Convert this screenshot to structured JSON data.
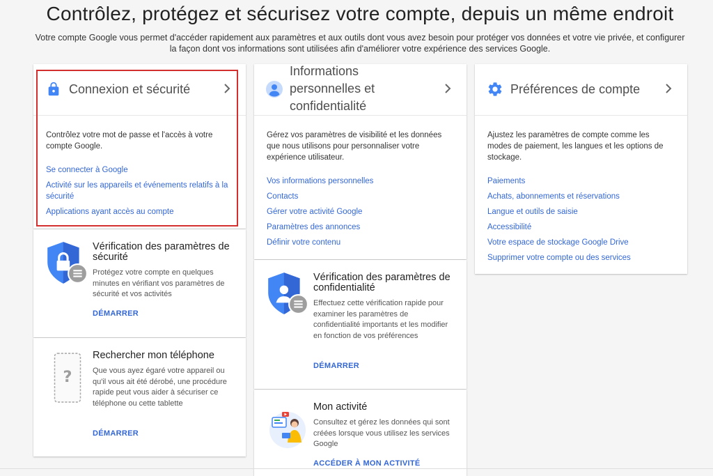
{
  "page": {
    "title": "Contrôlez, protégez et sécurisez votre compte, depuis un même endroit",
    "intro_line1": "Votre compte Google vous permet d'accéder rapidement aux paramètres et aux outils dont vous avez besoin pour protéger vos données et votre vie privée, et configurer",
    "intro_line2": "la façon dont vos informations sont utilisées afin d'améliorer votre expérience des services Google."
  },
  "colors": {
    "link": "#3367d6",
    "icon_blue": "#4285f4",
    "highlight": "#d32f2f"
  },
  "security_card": {
    "icon": "lock-icon",
    "title": "Connexion et sécurité",
    "description": "Contrôlez votre mot de passe et l'accès à votre compte Google.",
    "links": [
      "Se connecter à Google",
      "Activité sur les appareils et événements relatifs à la sécurité",
      "Applications ayant accès au compte"
    ]
  },
  "privacy_card": {
    "icon": "person-icon",
    "title": "Informations personnelles et confidentialité",
    "description": "Gérez vos paramètres de visibilité et les données que nous utilisons pour personnaliser votre expérience utilisateur.",
    "links": [
      "Vos informations personnelles",
      "Contacts",
      "Gérer votre activité Google",
      "Paramètres des annonces",
      "Définir votre contenu"
    ]
  },
  "preferences_card": {
    "icon": "gear-icon",
    "title": "Préférences de compte",
    "description": "Ajustez les paramètres de compte comme les modes de paiement, les langues et les options de stockage.",
    "links": [
      "Paiements",
      "Achats, abonnements et réservations",
      "Langue et outils de saisie",
      "Accessibilité",
      "Votre espace de stockage Google Drive",
      "Supprimer votre compte ou des services"
    ]
  },
  "security_checkup": {
    "icon": "shield-lock-icon",
    "title": "Vérification des paramètres de sécurité",
    "description": "Protégez votre compte en quelques minutes en vérifiant vos paramètres de sécurité et vos activités",
    "action": "DÉMARRER"
  },
  "find_phone": {
    "icon": "phone-question-icon",
    "title": "Rechercher mon téléphone",
    "description": "Que vous ayez égaré votre appareil ou qu'il vous ait été dérobé, une procédure rapide peut vous aider à sécuriser ce téléphone ou cette tablette",
    "action": "DÉMARRER"
  },
  "privacy_checkup": {
    "icon": "shield-person-icon",
    "title": "Vérification des paramètres de confidentialité",
    "description": "Effectuez cette vérification rapide pour examiner les paramètres de confidentialité importants et les modifier en fonction de vos préférences",
    "action": "DÉMARRER"
  },
  "my_activity": {
    "icon": "activity-illustration-icon",
    "title": "Mon activité",
    "description": "Consultez et gérez les données qui sont créées lorsque vous utilisez les services Google",
    "action": "ACCÉDER À MON ACTIVITÉ"
  }
}
